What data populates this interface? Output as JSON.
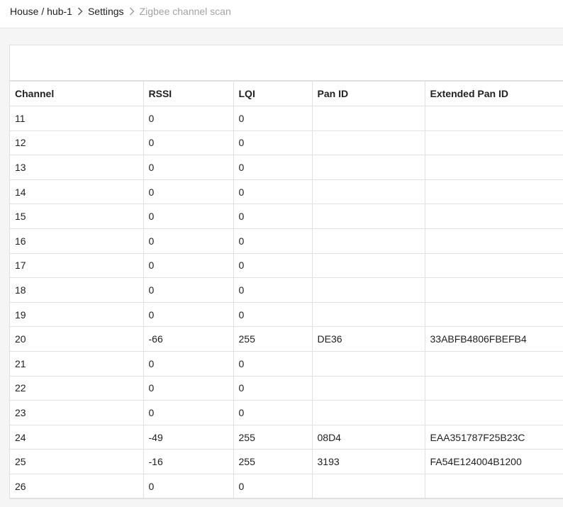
{
  "breadcrumb": {
    "items": [
      "House / hub-1",
      "Settings",
      "Zigbee channel scan"
    ]
  },
  "table": {
    "columns": [
      "Channel",
      "RSSI",
      "LQI",
      "Pan ID",
      "Extended Pan ID"
    ],
    "rows": [
      [
        "11",
        "0",
        "0",
        "",
        ""
      ],
      [
        "12",
        "0",
        "0",
        "",
        ""
      ],
      [
        "13",
        "0",
        "0",
        "",
        ""
      ],
      [
        "14",
        "0",
        "0",
        "",
        ""
      ],
      [
        "15",
        "0",
        "0",
        "",
        ""
      ],
      [
        "16",
        "0",
        "0",
        "",
        ""
      ],
      [
        "17",
        "0",
        "0",
        "",
        ""
      ],
      [
        "18",
        "0",
        "0",
        "",
        ""
      ],
      [
        "19",
        "0",
        "0",
        "",
        ""
      ],
      [
        "20",
        "-66",
        "255",
        "DE36",
        "33ABFB4806FBEFB4"
      ],
      [
        "21",
        "0",
        "0",
        "",
        ""
      ],
      [
        "22",
        "0",
        "0",
        "",
        ""
      ],
      [
        "23",
        "0",
        "0",
        "",
        ""
      ],
      [
        "24",
        "-49",
        "255",
        "08D4",
        "EAA351787F25B23C"
      ],
      [
        "25",
        "-16",
        "255",
        "3193",
        "FA54E124004B1200"
      ],
      [
        "26",
        "0",
        "0",
        "",
        ""
      ]
    ]
  },
  "icons": {
    "breadcrumb_separator": "chevron-right-icon"
  }
}
